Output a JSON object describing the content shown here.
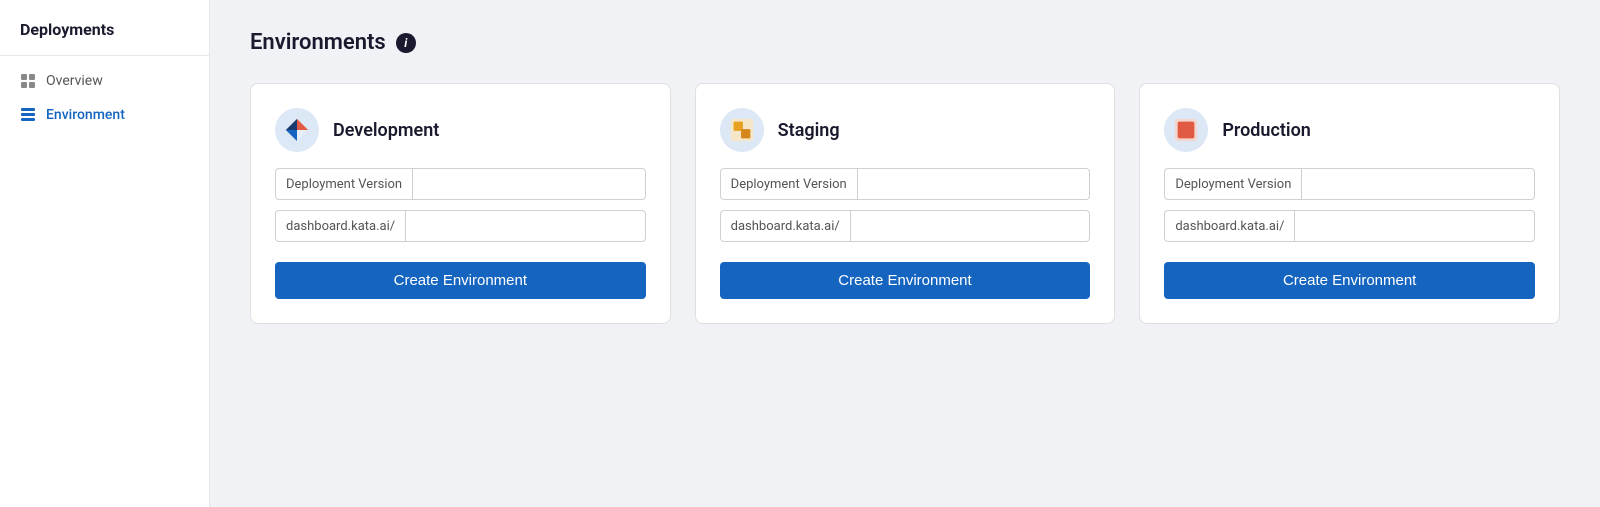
{
  "sidebar": {
    "title": "Deployments",
    "items": [
      {
        "label": "Overview",
        "icon": "overview-icon",
        "active": false
      },
      {
        "label": "Environment",
        "icon": "environment-icon",
        "active": true
      }
    ]
  },
  "page": {
    "title": "Environments",
    "info_icon": "i"
  },
  "environments": [
    {
      "name": "Development",
      "icon": "dev-icon",
      "deployment_version_label": "Deployment Version",
      "deployment_version_value": "",
      "url_label": "dashboard.kata.ai/",
      "url_value": "",
      "create_button": "Create Environment"
    },
    {
      "name": "Staging",
      "icon": "staging-icon",
      "deployment_version_label": "Deployment Version",
      "deployment_version_value": "",
      "url_label": "dashboard.kata.ai/",
      "url_value": "",
      "create_button": "Create Environment"
    },
    {
      "name": "Production",
      "icon": "prod-icon",
      "deployment_version_label": "Deployment Version",
      "deployment_version_value": "",
      "url_label": "dashboard.kata.ai/",
      "url_value": "",
      "create_button": "Create Environment"
    }
  ]
}
